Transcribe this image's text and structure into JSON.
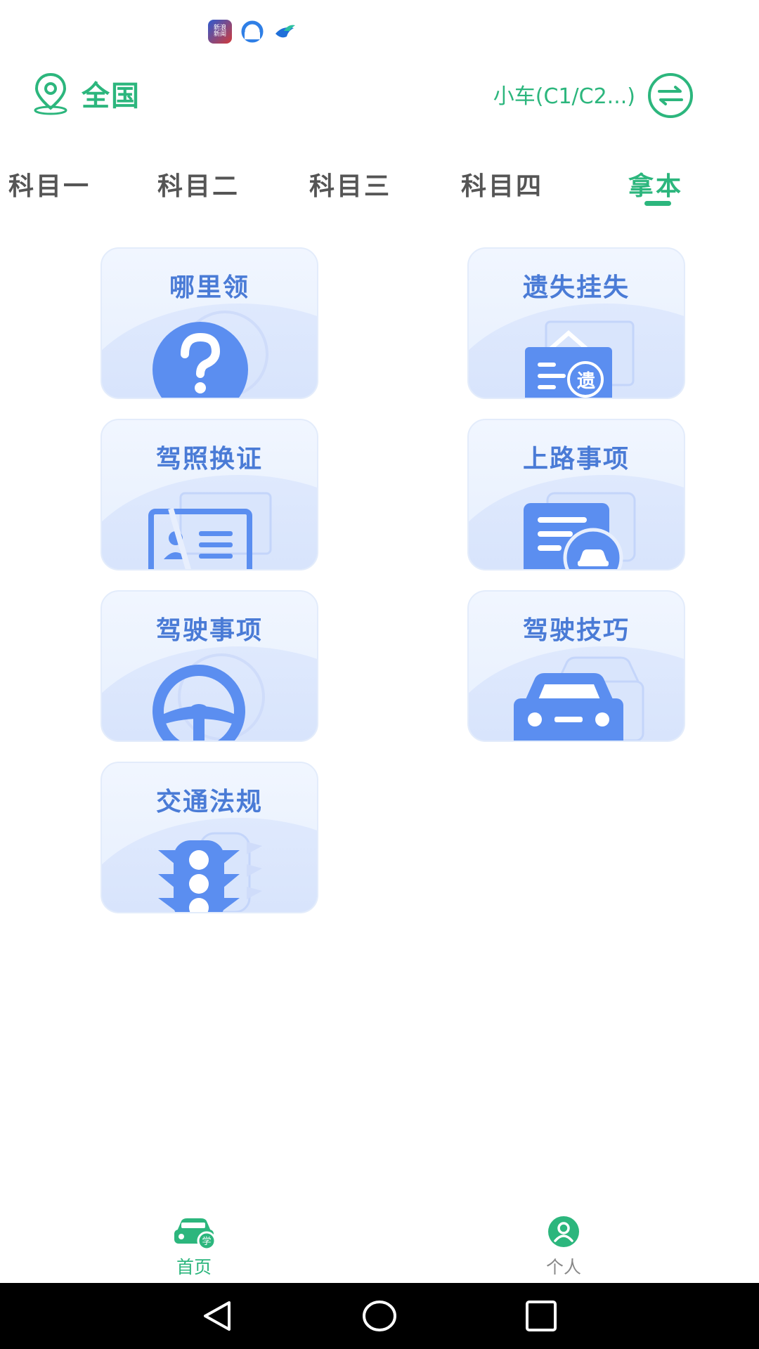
{
  "status_bar": {
    "app_icons": [
      "sina-news-icon",
      "browser-icon",
      "bird-app-icon"
    ],
    "news_icon_text": "新浪\n新闻"
  },
  "header": {
    "location": "全国",
    "car_type": "小车(C1/C2...)"
  },
  "tabs": [
    {
      "label": "科目一"
    },
    {
      "label": "科目二"
    },
    {
      "label": "科目三"
    },
    {
      "label": "科目四"
    },
    {
      "label": "拿本"
    }
  ],
  "active_tab_index": 4,
  "cards": [
    {
      "title": "哪里领",
      "icon": "question-icon"
    },
    {
      "title": "遗失挂失",
      "icon": "lost-sign-icon",
      "icon_text": "遗"
    },
    {
      "title": "驾照换证",
      "icon": "license-card-icon"
    },
    {
      "title": "上路事项",
      "icon": "document-car-icon"
    },
    {
      "title": "驾驶事项",
      "icon": "steering-wheel-icon"
    },
    {
      "title": "驾驶技巧",
      "icon": "car-icon"
    },
    {
      "title": "交通法规",
      "icon": "traffic-light-icon"
    }
  ],
  "bottom_nav": {
    "home": "首页",
    "me": "个人",
    "home_badge": "学"
  },
  "colors": {
    "accent": "#2cb67d",
    "card_title": "#4a7bd6",
    "icon_blue": "#5b8ef0"
  }
}
